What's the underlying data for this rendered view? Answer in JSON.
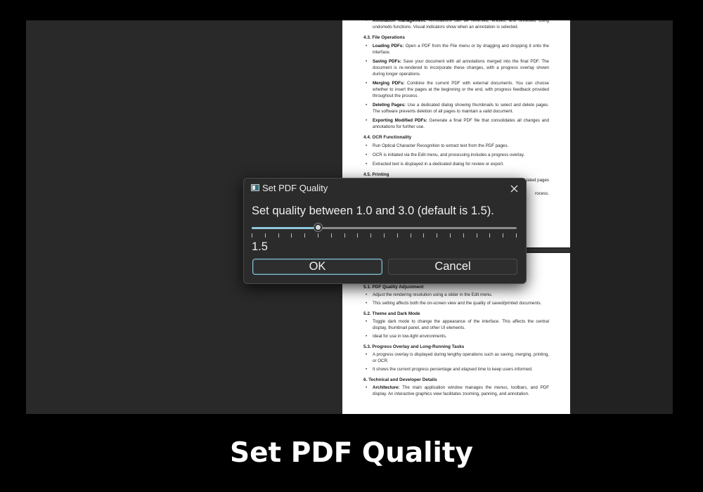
{
  "document": {
    "page1": {
      "top_bullet": {
        "bold": "Annotation management:",
        "text": " Annotations can be reversed, erased, and reviewed using undo/redo functions. Visual indicators show when an annotation is selected."
      },
      "sections": [
        {
          "heading": "4.3. File Operations",
          "items": [
            {
              "bold": "Loading PDFs:",
              "text": " Open a PDF from the File menu or by dragging and dropping it onto the interface."
            },
            {
              "bold": "Saving PDFs:",
              "text": " Save your document with all annotations merged into the final PDF. The document is re-rendered to incorporate these changes, with a progress overlay shown during longer operations."
            },
            {
              "bold": "Merging PDFs:",
              "text": " Combine the current PDF with external documents. You can choose whether to insert the pages at the beginning or the end, with progress feedback provided throughout the process."
            },
            {
              "bold": "Deleting Pages:",
              "text": " Use a dedicated dialog showing thumbnails to select and delete pages. The software prevents deletion of all pages to maintain a valid document."
            },
            {
              "bold": "Exporting Modified PDFs:",
              "text": " Generate a final PDF file that consolidates all changes and annotations for further use."
            }
          ]
        },
        {
          "heading": "4.4. OCR Functionality",
          "items": [
            {
              "bold": "",
              "text": "Run Optical Character Recognition to extract text from the PDF pages."
            },
            {
              "bold": "",
              "text": "OCR is initiated via the Edit menu, and processing includes a progress overlay."
            },
            {
              "bold": "",
              "text": "Extracted text is displayed in a dedicated dialog for review or export."
            }
          ]
        }
      ],
      "printing_heading": "4.5. Printing",
      "printing_partial_1": "tated pages",
      "printing_partial_2": "rocess."
    },
    "page2": {
      "sections": [
        {
          "heading": "5.1. PDF Quality Adjustment",
          "items": [
            {
              "bold": "",
              "text": "Adjust the rendering resolution using a slider in the Edit menu."
            },
            {
              "bold": "",
              "text": "This setting affects both the on-screen view and the quality of saved/printed documents."
            }
          ]
        },
        {
          "heading": "5.2. Theme and Dark Mode",
          "items": [
            {
              "bold": "",
              "text": "Toggle dark mode to change the appearance of the interface. This affects the central display, thumbnail panel, and other UI elements."
            },
            {
              "bold": "",
              "text": "Ideal for use in low-light environments."
            }
          ]
        },
        {
          "heading": "5.3. Progress Overlay and Long-Running Tasks",
          "items": [
            {
              "bold": "",
              "text": "A progress overlay is displayed during lengthy operations such as saving, merging, printing, or OCR."
            },
            {
              "bold": "",
              "text": "It shows the current progress percentage and elapsed time to keep users informed."
            }
          ]
        },
        {
          "heading": "6. Technical and Developer Details",
          "items": [
            {
              "bold": "Architecture:",
              "text": " The main application window manages the menus, toolbars, and PDF display. An interactive graphics view facilitates zooming, panning, and annotation."
            }
          ]
        }
      ]
    }
  },
  "dialog": {
    "title": "Set PDF Quality",
    "close_icon": "close-icon",
    "prompt": "Set quality between 1.0 and 3.0 (default is 1.5).",
    "slider": {
      "min": 1.0,
      "max": 3.0,
      "value": 1.5,
      "tick_count": 21
    },
    "value_label": "1.5",
    "ok_label": "OK",
    "cancel_label": "Cancel",
    "accent_color": "#8fc8dd"
  },
  "caption": "Set PDF Quality"
}
